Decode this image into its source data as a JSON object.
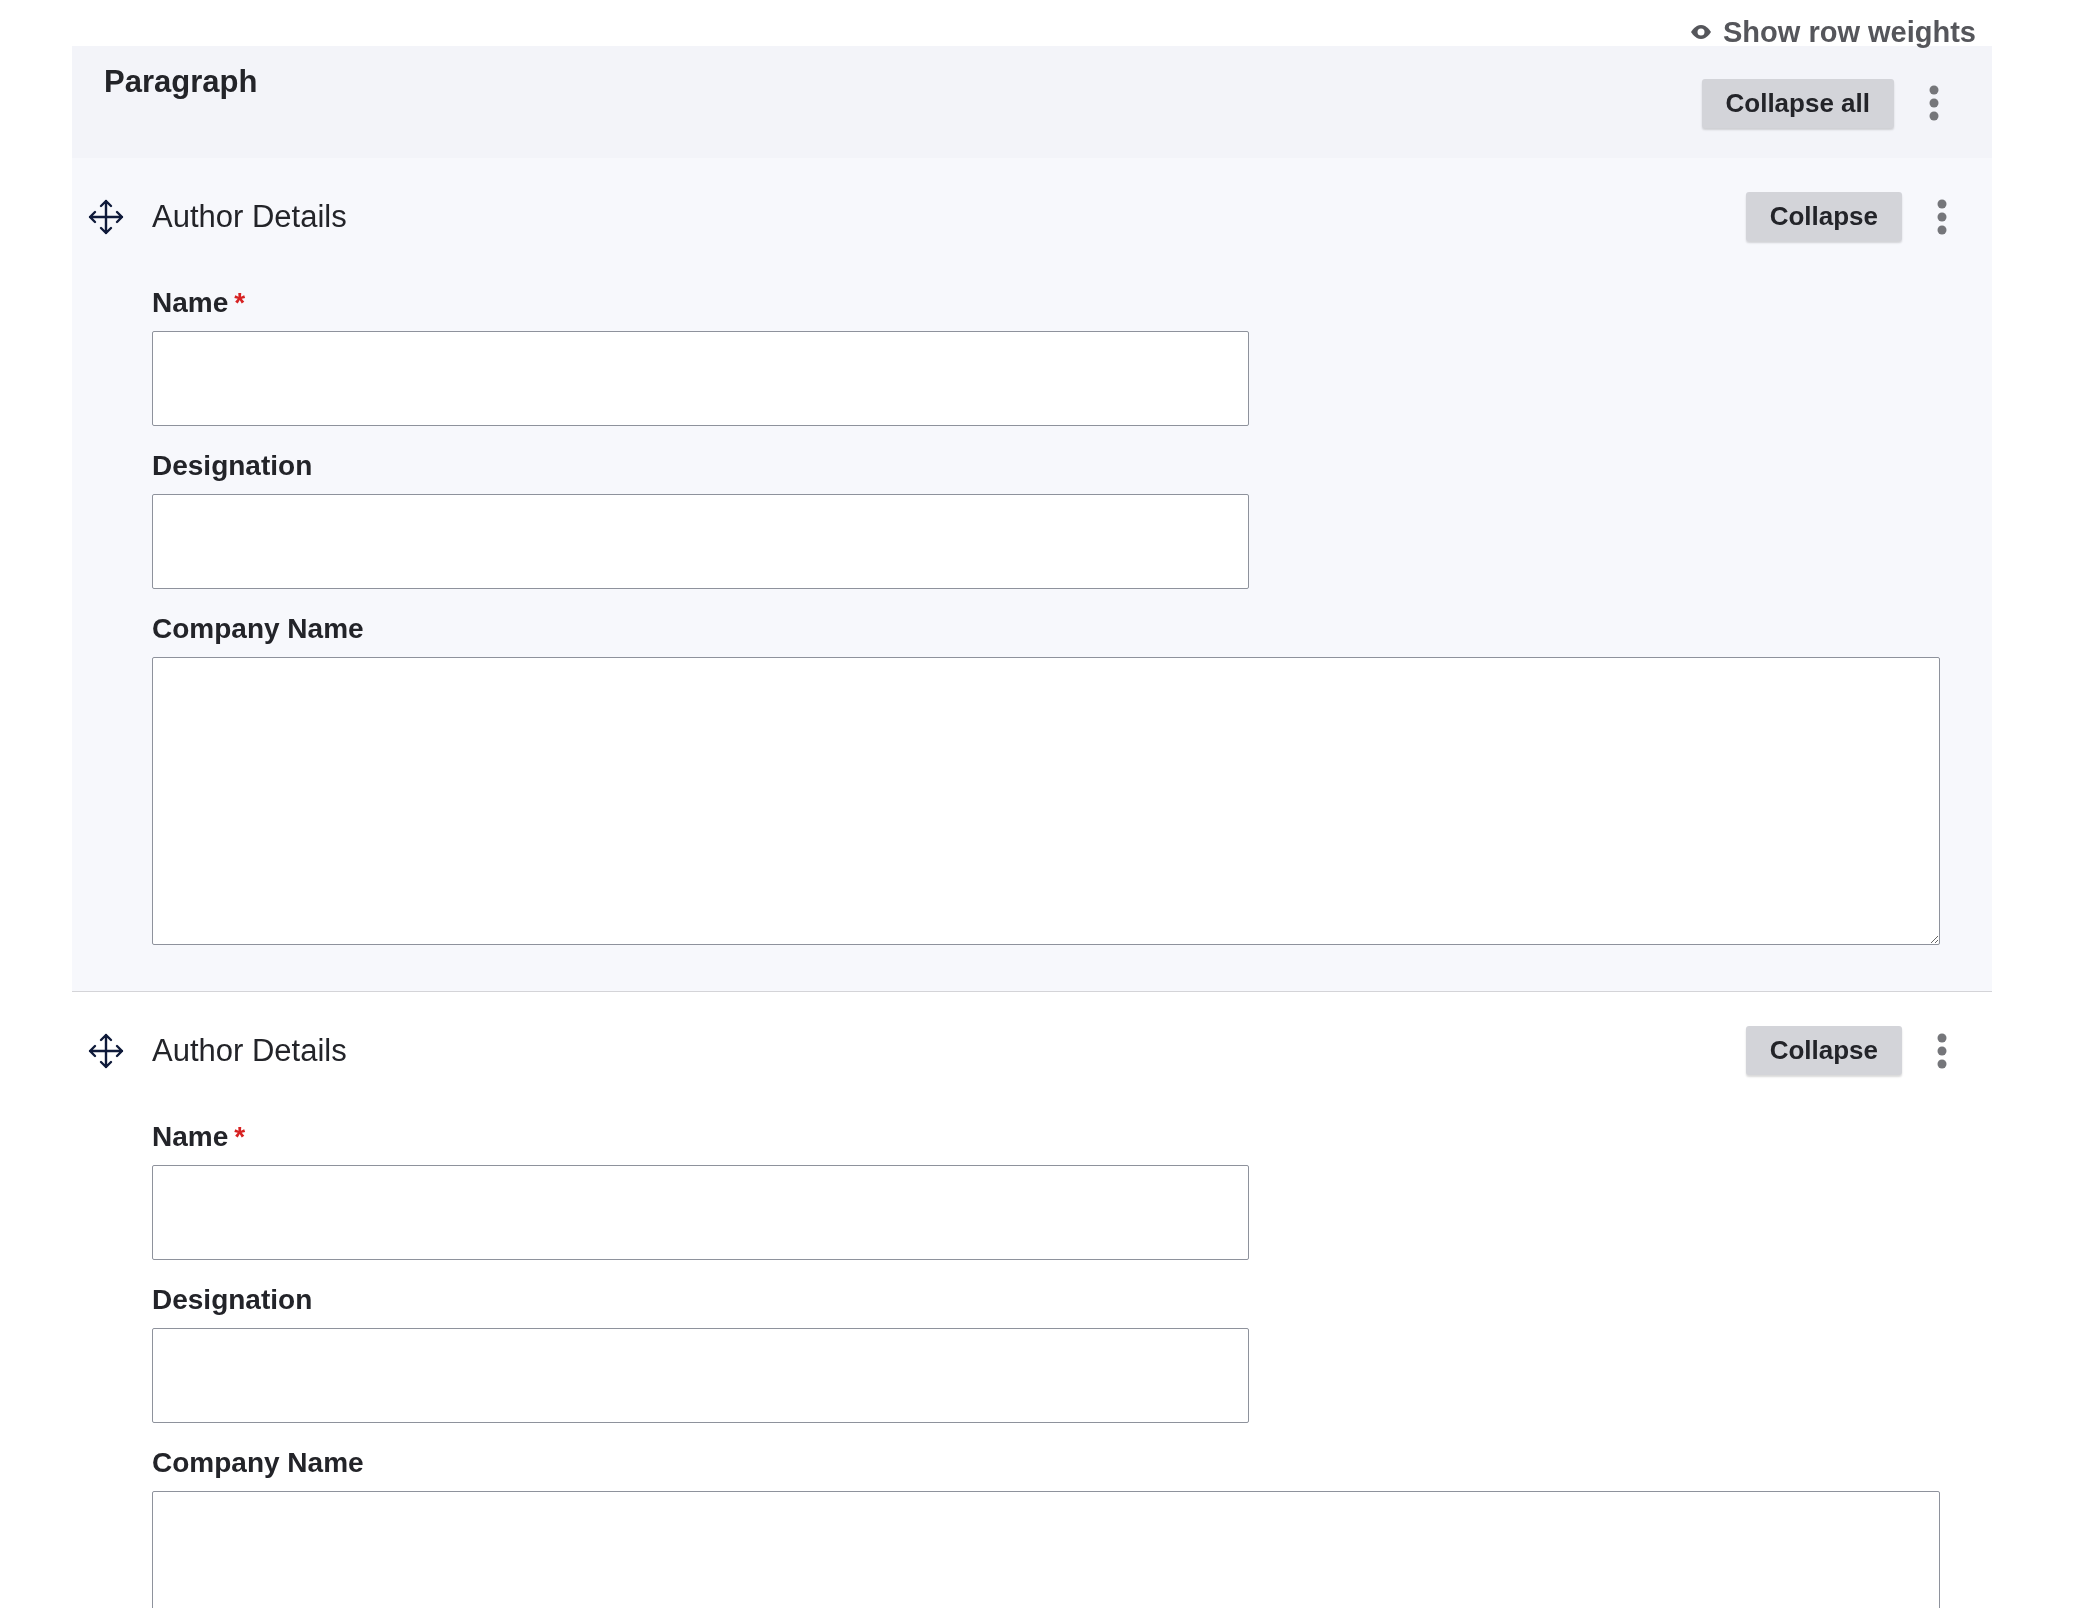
{
  "toolbar": {
    "link": "Show row weights"
  },
  "paragraph": {
    "title": "Paragraph",
    "collapse_all": "Collapse all"
  },
  "items": [
    {
      "title": "Author Details",
      "collapse": "Collapse",
      "fields": [
        {
          "kind": "input",
          "label": "Name",
          "required_mark": "*"
        },
        {
          "kind": "input",
          "label": "Designation"
        },
        {
          "kind": "textarea",
          "label": "Company Name"
        }
      ]
    },
    {
      "title": "Author Details",
      "collapse": "Collapse",
      "fields": [
        {
          "kind": "input",
          "label": "Name",
          "required_mark": "*"
        },
        {
          "kind": "input",
          "label": "Designation"
        },
        {
          "kind": "textarea",
          "label": "Company Name"
        }
      ]
    }
  ]
}
